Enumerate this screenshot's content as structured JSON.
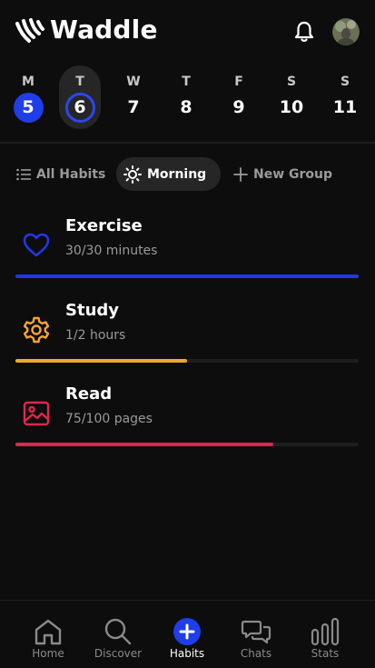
{
  "header": {
    "title": "Waddle"
  },
  "week": [
    {
      "day": "M",
      "date": "5",
      "state": "done"
    },
    {
      "day": "T",
      "date": "6",
      "state": "today"
    },
    {
      "day": "W",
      "date": "7",
      "state": ""
    },
    {
      "day": "T",
      "date": "8",
      "state": ""
    },
    {
      "day": "F",
      "date": "9",
      "state": ""
    },
    {
      "day": "S",
      "date": "10",
      "state": ""
    },
    {
      "day": "S",
      "date": "11",
      "state": ""
    }
  ],
  "groups": {
    "all": "All Habits",
    "morning": "Morning",
    "new_group": "New Group"
  },
  "habits": [
    {
      "name": "Exercise",
      "progress_text": "30/30 minutes",
      "progress": 1.0,
      "color": "#2335e6",
      "icon": "heart-icon"
    },
    {
      "name": "Study",
      "progress_text": "1/2 hours",
      "progress": 0.5,
      "color": "#f5a531",
      "icon": "gear-icon"
    },
    {
      "name": "Read",
      "progress_text": "75/100 pages",
      "progress": 0.75,
      "color": "#e0264e",
      "icon": "image-icon"
    }
  ],
  "nav": {
    "home": "Home",
    "discover": "Discover",
    "habits": "Habits",
    "chats": "Chats",
    "stats": "Stats"
  },
  "colors": {
    "accent": "#1f3de8",
    "background": "#0d0d0d"
  }
}
